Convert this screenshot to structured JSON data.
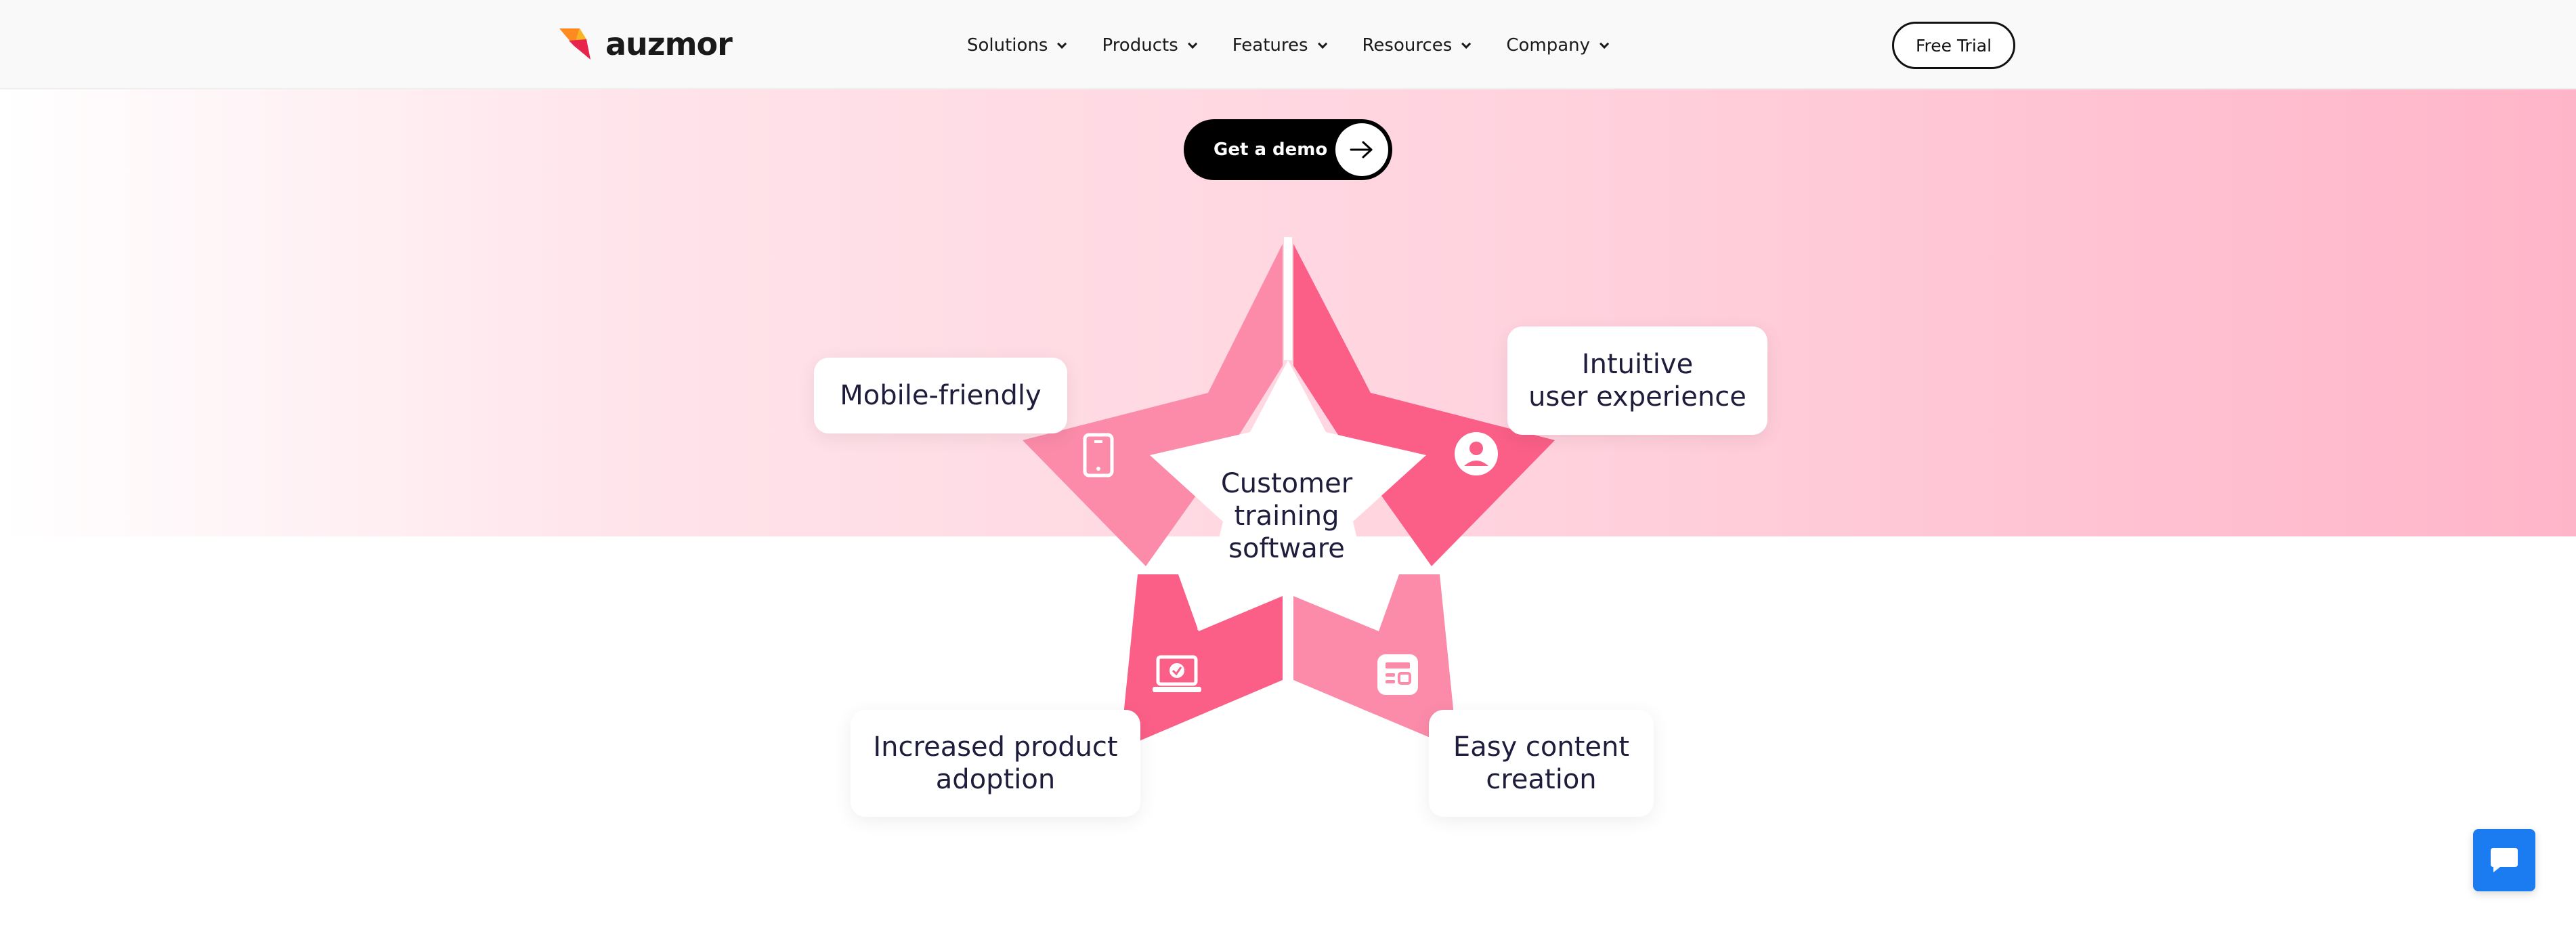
{
  "header": {
    "logo_text": "auzmor",
    "nav": [
      {
        "label": "Solutions"
      },
      {
        "label": "Products"
      },
      {
        "label": "Features"
      },
      {
        "label": "Resources"
      },
      {
        "label": "Company"
      }
    ],
    "free_trial_label": "Free Trial"
  },
  "hero": {
    "demo_label": "Get a demo"
  },
  "diagram": {
    "center_lines": [
      "Customer",
      "training",
      "software"
    ],
    "cards": {
      "mobile": [
        "Mobile-friendly"
      ],
      "ux": [
        "Intuitive",
        "user experience"
      ],
      "adoption": [
        "Increased product",
        "adoption"
      ],
      "content": [
        "Easy content",
        "creation"
      ]
    },
    "icons": [
      "mobile-phone-icon",
      "user-icon",
      "laptop-check-icon",
      "content-layout-icon"
    ],
    "colors": {
      "light_pink": "#fb8ba9",
      "dark_pink": "#fb5f87",
      "hero_right": "#ffb5c9"
    }
  },
  "chat": {
    "icon": "chat-bubble-icon",
    "color": "#1a7cf0"
  }
}
